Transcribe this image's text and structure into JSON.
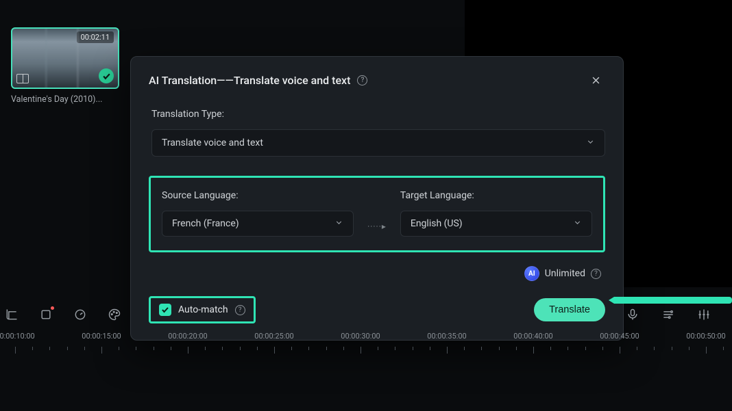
{
  "media": {
    "clip_duration": "00:02:11",
    "clip_title": "Valentine's Day (2010)..."
  },
  "modal": {
    "title": "AI Translation——Translate voice and text",
    "type_label": "Translation Type:",
    "type_value": "Translate voice and text",
    "source_label": "Source Language:",
    "source_value": "French (France)",
    "target_label": "Target Language:",
    "target_value": "English (US)",
    "ai_badge": "AI",
    "unlimited": "Unlimited",
    "auto_match": "Auto-match",
    "translate": "Translate"
  },
  "timeline": {
    "labels": [
      "00:00:10:00",
      "00:00:15:00",
      "00:00:20:00",
      "00:00:25:00",
      "00:00:30:00",
      "00:00:35:00",
      "00:00:40:00",
      "00:00:45:00",
      "00:00:50:00"
    ]
  }
}
